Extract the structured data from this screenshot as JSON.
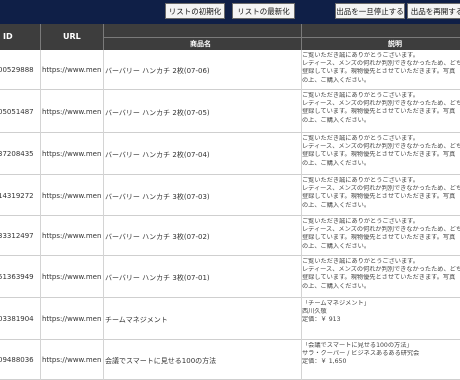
{
  "toolbar": {
    "buttons": [
      {
        "label": "リストの初期化"
      },
      {
        "label": "リストの最新化"
      },
      {
        "label": "出品を一旦停止する"
      },
      {
        "label": "出品を再開する"
      }
    ]
  },
  "table": {
    "headers": {
      "id": "ID",
      "url": "URL",
      "name": "商品名",
      "desc": "説明"
    },
    "rows": [
      {
        "id": "00529888",
        "url": "https://www.men",
        "name": "バーバリー ハンカチ 2枚(07-06)",
        "desc": [
          "ご覧いただき誠にありがとうございます。",
          "レディース、メンズの何れか判別できなかったため、どちらも出品",
          "登録しています。現物優先とさせていただきます。写真",
          "の上、ご購入ください。"
        ]
      },
      {
        "id": "05051487",
        "url": "https://www.men",
        "name": "バーバリー ハンカチ 2枚(07-05)",
        "desc": [
          "ご覧いただき誠にありがとうございます。",
          "レディース、メンズの何れか判別できなかったため、どちらも出品",
          "登録しています。現物優先とさせていただきます。写真",
          "の上、ご購入ください。"
        ]
      },
      {
        "id": "37208435",
        "url": "https://www.men",
        "name": "バーバリー ハンカチ 2枚(07-04)",
        "desc": [
          "ご覧いただき誠にありがとうございます。",
          "レディース、メンズの何れか判別できなかったため、どちらも出品",
          "登録しています。現物優先とさせていただきます。写真",
          "の上、ご購入ください。"
        ]
      },
      {
        "id": "14319272",
        "url": "https://www.men",
        "name": "バーバリー ハンカチ 3枚(07-03)",
        "desc": [
          "ご覧いただき誠にありがとうございます。",
          "レディース、メンズの何れか判別できなかったため、どちらも出品",
          "登録しています。現物優先とさせていただきます。写真",
          "の上、ご購入ください。"
        ]
      },
      {
        "id": "33312497",
        "url": "https://www.men",
        "name": "バーバリー ハンカチ 3枚(07-02)",
        "desc": [
          "ご覧いただき誠にありがとうございます。",
          "レディース、メンズの何れか判別できなかったため、どちらも出品",
          "登録しています。現物優先とさせていただきます。写真",
          "の上、ご購入ください。"
        ]
      },
      {
        "id": "51363949",
        "url": "https://www.men",
        "name": "バーバリー ハンカチ 3枚(07-01)",
        "desc": [
          "ご覧いただき誠にありがとうございます。",
          "レディース、メンズの何れか判別できなかったため、どちらも出品",
          "登録しています。現物優先とさせていただきます。写真",
          "の上、ご購入ください。"
        ]
      },
      {
        "id": "03381904",
        "url": "https://www.men",
        "name": "チームマネジメント",
        "desc": [
          "「チームマネジメント」",
          "西川久敬",
          "定価：￥ 913"
        ]
      },
      {
        "id": "09488036",
        "url": "https://www.men",
        "name": "会議でスマートに見せる100の方法",
        "desc": [
          "「会議でスマートに見せる100の方法」",
          "サラ・クーパー / ビジネスあるある研究会",
          "定価：￥ 1,650"
        ]
      }
    ]
  },
  "colors": {
    "topbar": "#0f1f47",
    "header": "#3d3d3d"
  }
}
